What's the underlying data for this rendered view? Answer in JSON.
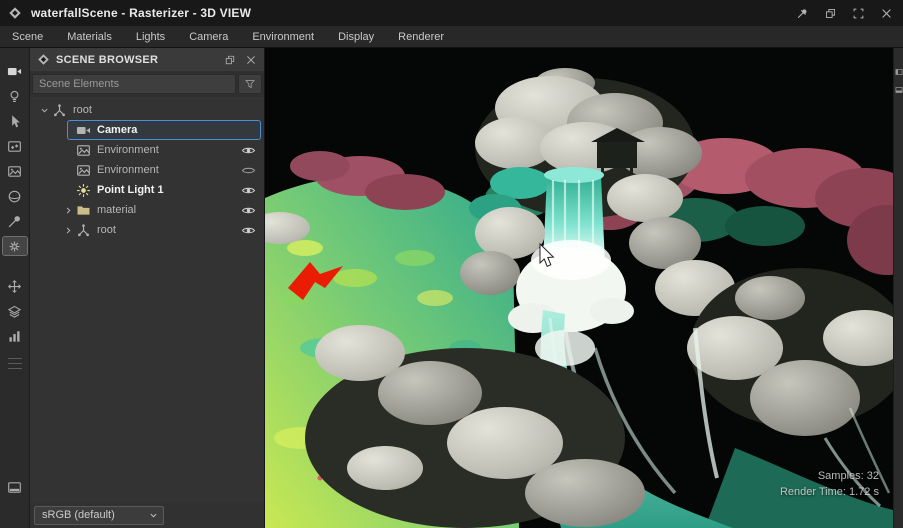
{
  "window": {
    "title": "waterfallScene - Rasterizer - 3D VIEW",
    "controls": [
      "pin",
      "restore",
      "fullscreen",
      "close"
    ]
  },
  "menu": {
    "items": [
      "Scene",
      "Materials",
      "Lights",
      "Camera",
      "Environment",
      "Display",
      "Renderer"
    ]
  },
  "left_toolbar": {
    "icons": [
      "video-camera",
      "light-bulb",
      "select-cursor",
      "image-keyframes",
      "image",
      "sphere",
      "color-picker",
      "render-settings",
      "transform-move",
      "layers",
      "statistics",
      "panel-toggle"
    ],
    "selected": "render-settings"
  },
  "scene_browser": {
    "title": "SCENE BROWSER",
    "search_placeholder": "Scene Elements",
    "tree": [
      {
        "label": "root",
        "icon": "node",
        "level": 0,
        "expanded": true
      },
      {
        "label": "Camera",
        "icon": "camera",
        "level": 1,
        "selected": true
      },
      {
        "label": "Environment",
        "icon": "environment",
        "level": 1,
        "visible": true
      },
      {
        "label": "Environment",
        "icon": "environment",
        "level": 1,
        "visible": false
      },
      {
        "label": "Point Light 1",
        "icon": "point-light",
        "level": 1,
        "visible": true
      },
      {
        "label": "material",
        "icon": "folder",
        "level": 1,
        "collapsed": true,
        "visible": true
      },
      {
        "label": "root",
        "icon": "node",
        "level": 1,
        "collapsed": true,
        "visible": true
      }
    ]
  },
  "viewport": {
    "overlay": {
      "samples": "Samples: 32",
      "render_time": "Render Time: 1.72 s"
    }
  },
  "right_toolbar": {
    "icons": [
      "side-panel-left",
      "side-panel-bottom"
    ]
  },
  "footer": {
    "colorspace": "sRGB (default)"
  },
  "colors": {
    "selection_accent": "#4b8fd5",
    "bird_red": "#ea1c04",
    "waterfall_teal": "#3fc4a6"
  }
}
